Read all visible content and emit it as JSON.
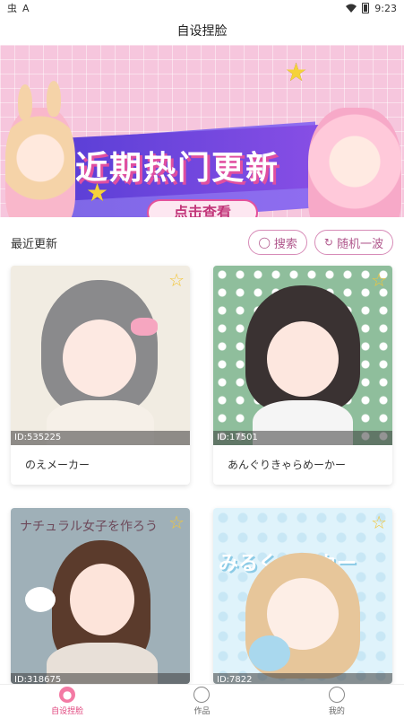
{
  "status_bar": {
    "left_glyphs": [
      "虫",
      "A"
    ],
    "time": "9:23"
  },
  "header": {
    "title": "自设捏脸"
  },
  "banner": {
    "headline": "近期热门更新",
    "cta": "点击查看"
  },
  "section": {
    "title": "最近更新",
    "search_label": "搜索",
    "random_label": "随机一波"
  },
  "cards": [
    {
      "id": "ID:535225",
      "name": "のえメーカー"
    },
    {
      "id": "ID:17501",
      "name": "あんぐりきゃらめーかー"
    },
    {
      "id": "ID:318675",
      "name": "",
      "image_text": "ナチュラル女子を作ろう"
    },
    {
      "id": "ID:7822",
      "name": "",
      "image_text": "みるくメーカー"
    }
  ],
  "bottom_nav": {
    "items": [
      {
        "label": "自设捏脸",
        "active": true,
        "icon": "palette-icon"
      },
      {
        "label": "作品",
        "active": false,
        "icon": "planet-icon"
      },
      {
        "label": "我的",
        "active": false,
        "icon": "user-icon"
      }
    ]
  },
  "colors": {
    "accent": "#e0457d",
    "chip_border": "#d78bb7",
    "banner_purple": "#7d67e6"
  }
}
